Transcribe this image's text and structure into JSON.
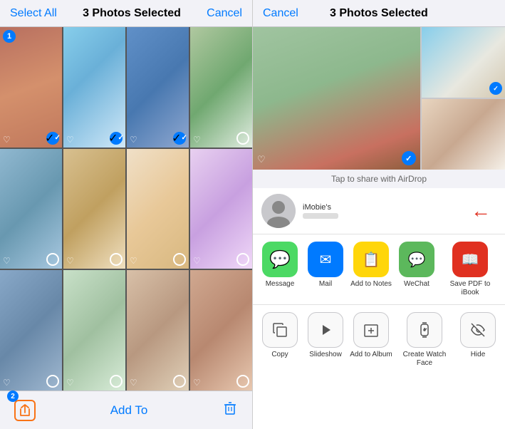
{
  "left": {
    "header": {
      "select_all": "Select All",
      "title": "3 Photos Selected",
      "cancel": "Cancel"
    },
    "photos": [
      {
        "id": 1,
        "color": "c1",
        "selected": true,
        "badge": "1"
      },
      {
        "id": 2,
        "color": "c2",
        "selected": true,
        "badge": null
      },
      {
        "id": 3,
        "color": "c3",
        "selected": true,
        "badge": null
      },
      {
        "id": 4,
        "color": "c4",
        "selected": false,
        "badge": null
      },
      {
        "id": 5,
        "color": "c5",
        "selected": false,
        "badge": null
      },
      {
        "id": 6,
        "color": "c6",
        "selected": false,
        "badge": null
      },
      {
        "id": 7,
        "color": "c7",
        "selected": false,
        "badge": null
      },
      {
        "id": 8,
        "color": "c8",
        "selected": false,
        "badge": null
      },
      {
        "id": 9,
        "color": "c9",
        "selected": false,
        "badge": null
      },
      {
        "id": 10,
        "color": "c10",
        "selected": false,
        "badge": null
      },
      {
        "id": 11,
        "color": "c11",
        "selected": false,
        "badge": null
      },
      {
        "id": 12,
        "color": "c12",
        "selected": false,
        "badge": null
      }
    ],
    "footer": {
      "badge": "2",
      "add_to": "Add To"
    }
  },
  "right": {
    "header": {
      "cancel": "Cancel",
      "title": "3 Photos Selected"
    },
    "airdrop_hint": "Tap to share with AirDrop",
    "contact": {
      "name": "iMobie's"
    },
    "share_apps": [
      {
        "id": "message",
        "label": "Message",
        "icon": "💬",
        "color_class": "icon-message"
      },
      {
        "id": "mail",
        "label": "Mail",
        "icon": "✉",
        "color_class": "icon-mail"
      },
      {
        "id": "notes",
        "label": "Add to Notes",
        "icon": "📝",
        "color_class": "icon-notes"
      },
      {
        "id": "wechat",
        "label": "WeChat",
        "icon": "💬",
        "color_class": "icon-wechat"
      },
      {
        "id": "books",
        "label": "Save PDF to iBook",
        "icon": "📖",
        "color_class": "icon-books"
      }
    ],
    "actions": [
      {
        "id": "copy",
        "label": "Copy",
        "icon": "⧉"
      },
      {
        "id": "slideshow",
        "label": "Slideshow",
        "icon": "▶"
      },
      {
        "id": "add-album",
        "label": "Add to Album",
        "icon": "⊕"
      },
      {
        "id": "watch-face",
        "label": "Create Watch Face",
        "icon": "⌚"
      },
      {
        "id": "hide",
        "label": "Hide",
        "icon": "⊗"
      }
    ]
  }
}
